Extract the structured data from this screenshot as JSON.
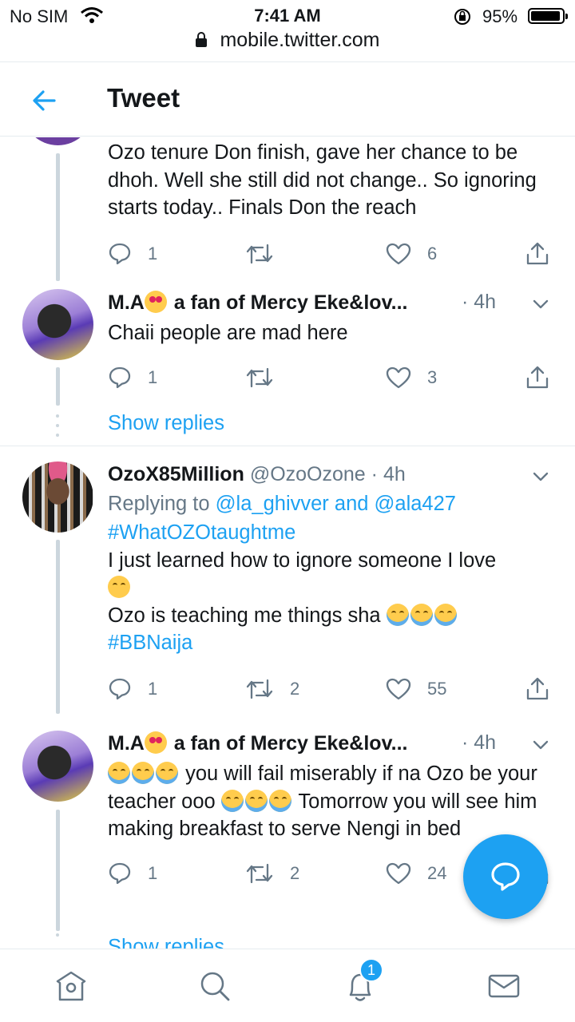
{
  "status_bar": {
    "carrier": "No SIM",
    "time": "7:41 AM",
    "battery": "95%"
  },
  "url_bar": {
    "url": "mobile.twitter.com"
  },
  "header": {
    "title": "Tweet"
  },
  "tweets": [
    {
      "text": "Ozo tenure Don finish, gave her chance to be dhoh. Well she still did not change.. So ignoring starts today.. Finals Don the reach",
      "replies": "1",
      "retweets": "",
      "likes": "6"
    },
    {
      "name_pre": "M.A",
      "name_post": " a fan of Mercy Eke&lov...",
      "dot": "·",
      "time": "4h",
      "text": "Chaii people are mad here",
      "replies": "1",
      "retweets": "",
      "likes": "3",
      "show_replies": "Show replies"
    },
    {
      "name": "OzoX85Million",
      "handle": "@OzoOzone",
      "dot": "·",
      "time": "4h",
      "replying_prefix": "Replying to ",
      "replying_user1": "@la_ghivver",
      "replying_and": " and ",
      "replying_user2": "@ala427",
      "hashtag1": "#WhatOZOtaughtme",
      "line1": "I just learned how to ignore someone I love",
      "line2": "Ozo is teaching me things sha",
      "hashtag2": "#BBNaija",
      "replies": "1",
      "retweets": "2",
      "likes": "55"
    },
    {
      "name_pre": "M.A",
      "name_post": " a fan of Mercy Eke&lov...",
      "dot": "·",
      "time": "4h",
      "text_a": " you will fail miserably if na Ozo be your teacher ooo ",
      "text_b": " Tomorrow you will see him making breakfast to serve Nengi in bed",
      "replies": "1",
      "retweets": "2",
      "likes": "24",
      "show_replies": "Show replies"
    }
  ],
  "tabbar": {
    "notification_count": "1"
  }
}
